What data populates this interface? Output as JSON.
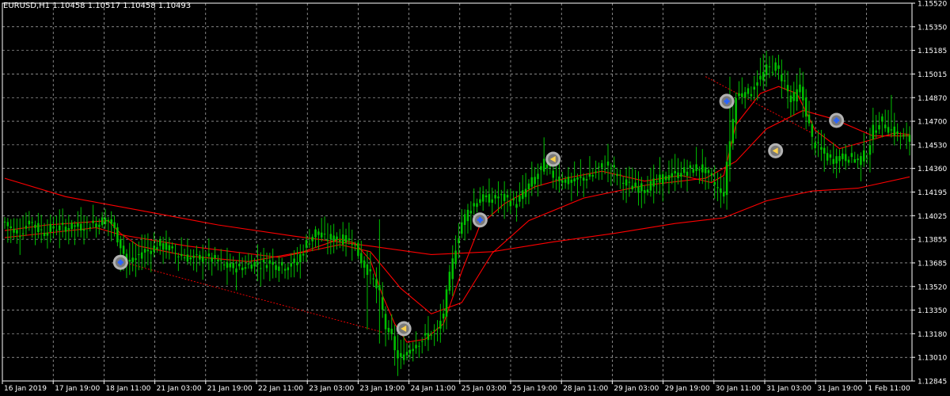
{
  "header": {
    "title": "EURUSD,H1  1.10458 1.10517 1.10458 1.10493"
  },
  "colors": {
    "background": "#000000",
    "grid": "#ffffff",
    "axis": "#ffffff",
    "candle": "#00c000",
    "ma": "#ff0000",
    "signal_buy_fill": "#2a64ff",
    "signal_sell_fill": "#ffd24a",
    "signal_ring": "#bcbcbc"
  },
  "chart_data": {
    "type": "candlestick",
    "symbol": "EURUSD",
    "timeframe": "H1",
    "ohlc_header": "1.10458 1.10517 1.10458 1.10493",
    "ylim": [
      1.12845,
      1.1552
    ],
    "y_ticks": [
      "1.15520",
      "1.15350",
      "1.15185",
      "1.15015",
      "1.14870",
      "1.14700",
      "1.14530",
      "1.14360",
      "1.14195",
      "1.14025",
      "1.13855",
      "1.13685",
      "1.13520",
      "1.13350",
      "1.13180",
      "1.13010",
      "1.12845"
    ],
    "x_ticks": [
      "16 Jan 2019",
      "17 Jan 19:00",
      "18 Jan 11:00",
      "21 Jan 03:00",
      "21 Jan 19:00",
      "22 Jan 11:00",
      "23 Jan 03:00",
      "23 Jan 19:00",
      "24 Jan 11:00",
      "25 Jan 03:00",
      "25 Jan 19:00",
      "28 Jan 11:00",
      "29 Jan 03:00",
      "29 Jan 19:00",
      "30 Jan 11:00",
      "31 Jan 03:00",
      "31 Jan 19:00",
      "1 Feb 11:00"
    ],
    "grid": true,
    "close_path": [
      [
        0,
        1.1397
      ],
      [
        2,
        1.1392
      ],
      [
        5,
        1.1389
      ],
      [
        8,
        1.1398
      ],
      [
        11,
        1.1392
      ],
      [
        13,
        1.139
      ],
      [
        16,
        1.1393
      ],
      [
        19,
        1.1393
      ],
      [
        22,
        1.1394
      ],
      [
        25,
        1.1394
      ],
      [
        28,
        1.1396
      ],
      [
        30,
        1.1396
      ],
      [
        33,
        1.1399
      ],
      [
        35,
        1.1396
      ],
      [
        38,
        1.1381
      ],
      [
        40,
        1.1369
      ],
      [
        42,
        1.1369
      ],
      [
        45,
        1.1376
      ],
      [
        48,
        1.1378
      ],
      [
        51,
        1.1381
      ],
      [
        54,
        1.1378
      ],
      [
        57,
        1.1374
      ],
      [
        60,
        1.1372
      ],
      [
        63,
        1.1371
      ],
      [
        66,
        1.1372
      ],
      [
        69,
        1.137
      ],
      [
        72,
        1.1366
      ],
      [
        75,
        1.1365
      ],
      [
        78,
        1.1365
      ],
      [
        81,
        1.1368
      ],
      [
        84,
        1.1367
      ],
      [
        87,
        1.1369
      ],
      [
        90,
        1.1366
      ],
      [
        93,
        1.1366
      ],
      [
        96,
        1.1369
      ],
      [
        99,
        1.1382
      ],
      [
        102,
        1.139
      ],
      [
        105,
        1.1385
      ],
      [
        108,
        1.1386
      ],
      [
        111,
        1.1385
      ],
      [
        114,
        1.1384
      ],
      [
        117,
        1.137
      ],
      [
        120,
        1.136
      ],
      [
        123,
        1.1345
      ],
      [
        125,
        1.1322
      ],
      [
        127,
        1.1315
      ],
      [
        129,
        1.13
      ],
      [
        131,
        1.1303
      ],
      [
        134,
        1.131
      ],
      [
        137,
        1.1314
      ],
      [
        140,
        1.1319
      ],
      [
        142,
        1.132
      ],
      [
        144,
        1.1333
      ],
      [
        146,
        1.1358
      ],
      [
        148,
        1.138
      ],
      [
        150,
        1.1397
      ],
      [
        153,
        1.1408
      ],
      [
        156,
        1.1414
      ],
      [
        159,
        1.1413
      ],
      [
        162,
        1.1415
      ],
      [
        165,
        1.1413
      ],
      [
        168,
        1.141
      ],
      [
        171,
        1.142
      ],
      [
        174,
        1.1428
      ],
      [
        177,
        1.1438
      ],
      [
        180,
        1.143
      ],
      [
        183,
        1.1427
      ],
      [
        186,
        1.1425
      ],
      [
        189,
        1.1428
      ],
      [
        192,
        1.1429
      ],
      [
        195,
        1.1435
      ],
      [
        198,
        1.1438
      ],
      [
        201,
        1.143
      ],
      [
        204,
        1.1423
      ],
      [
        207,
        1.1422
      ],
      [
        210,
        1.1421
      ],
      [
        213,
        1.1424
      ],
      [
        216,
        1.1428
      ],
      [
        219,
        1.143
      ],
      [
        222,
        1.1432
      ],
      [
        225,
        1.1434
      ],
      [
        228,
        1.1436
      ],
      [
        231,
        1.143
      ],
      [
        234,
        1.142
      ],
      [
        236,
        1.1418
      ],
      [
        238,
        1.1455
      ],
      [
        240,
        1.1485
      ],
      [
        242,
        1.149
      ],
      [
        244,
        1.1488
      ],
      [
        247,
        1.1496
      ],
      [
        250,
        1.1505
      ],
      [
        253,
        1.1507
      ],
      [
        256,
        1.1496
      ],
      [
        258,
        1.1482
      ],
      [
        261,
        1.1492
      ],
      [
        263,
        1.1475
      ],
      [
        265,
        1.1455
      ],
      [
        268,
        1.1447
      ],
      [
        271,
        1.1441
      ],
      [
        274,
        1.1443
      ],
      [
        277,
        1.1443
      ],
      [
        280,
        1.144
      ],
      [
        283,
        1.1446
      ],
      [
        285,
        1.1462
      ],
      [
        288,
        1.1468
      ],
      [
        291,
        1.1462
      ],
      [
        294,
        1.1458
      ],
      [
        297,
        1.1455
      ]
    ],
    "spikes": [
      {
        "i": 38,
        "low": 1.1362
      },
      {
        "i": 119,
        "low": 1.1321
      },
      {
        "i": 123,
        "low": 1.1311
      },
      {
        "i": 123,
        "high": 1.1399
      },
      {
        "i": 129,
        "low": 1.1288
      },
      {
        "i": 177,
        "high": 1.1457
      },
      {
        "i": 235,
        "low": 1.1407
      },
      {
        "i": 238,
        "high": 1.15
      },
      {
        "i": 252,
        "high": 1.1515
      },
      {
        "i": 279,
        "low": 1.1439
      },
      {
        "i": 291,
        "high": 1.1487
      },
      {
        "i": 282,
        "high": 1.146
      }
    ],
    "series": [
      {
        "type": "line",
        "style": "solid",
        "values": [
          [
            0,
            1.1391
          ],
          [
            14,
            1.1395
          ],
          [
            34,
            1.1398
          ],
          [
            38,
            1.1389
          ],
          [
            44,
            1.138
          ],
          [
            60,
            1.1373
          ],
          [
            80,
            1.1369
          ],
          [
            98,
            1.1376
          ],
          [
            110,
            1.1385
          ],
          [
            115,
            1.1382
          ],
          [
            120,
            1.137
          ],
          [
            124,
            1.1345
          ],
          [
            128,
            1.1325
          ],
          [
            132,
            1.1312
          ],
          [
            138,
            1.1314
          ],
          [
            144,
            1.1325
          ],
          [
            150,
            1.1362
          ],
          [
            156,
            1.1395
          ],
          [
            164,
            1.141
          ],
          [
            174,
            1.1422
          ],
          [
            184,
            1.1428
          ],
          [
            196,
            1.1433
          ],
          [
            210,
            1.1426
          ],
          [
            222,
            1.143
          ],
          [
            232,
            1.1425
          ],
          [
            236,
            1.143
          ],
          [
            240,
            1.1466
          ],
          [
            248,
            1.1488
          ],
          [
            254,
            1.1493
          ],
          [
            260,
            1.1488
          ],
          [
            266,
            1.1462
          ],
          [
            274,
            1.1449
          ],
          [
            284,
            1.1455
          ],
          [
            292,
            1.146
          ],
          [
            297,
            1.1459
          ]
        ]
      },
      {
        "type": "line",
        "style": "solid",
        "values": [
          [
            0,
            1.1386
          ],
          [
            30,
            1.1393
          ],
          [
            38,
            1.1388
          ],
          [
            60,
            1.138
          ],
          [
            90,
            1.1372
          ],
          [
            110,
            1.1381
          ],
          [
            120,
            1.1376
          ],
          [
            130,
            1.135
          ],
          [
            140,
            1.1332
          ],
          [
            150,
            1.134
          ],
          [
            160,
            1.1375
          ],
          [
            172,
            1.1398
          ],
          [
            190,
            1.1414
          ],
          [
            210,
            1.1423
          ],
          [
            230,
            1.1428
          ],
          [
            240,
            1.144
          ],
          [
            250,
            1.1463
          ],
          [
            262,
            1.1476
          ],
          [
            272,
            1.147
          ],
          [
            285,
            1.1458
          ],
          [
            297,
            1.1458
          ]
        ]
      },
      {
        "type": "line",
        "style": "solid",
        "values": [
          [
            0,
            1.1428
          ],
          [
            20,
            1.1415
          ],
          [
            45,
            1.1405
          ],
          [
            70,
            1.1395
          ],
          [
            95,
            1.1387
          ],
          [
            120,
            1.138
          ],
          [
            140,
            1.1374
          ],
          [
            160,
            1.1376
          ],
          [
            180,
            1.1383
          ],
          [
            200,
            1.1389
          ],
          [
            220,
            1.1396
          ],
          [
            236,
            1.14
          ],
          [
            250,
            1.1412
          ],
          [
            265,
            1.1419
          ],
          [
            280,
            1.1421
          ],
          [
            297,
            1.1429
          ]
        ]
      },
      {
        "type": "line",
        "style": "dotted",
        "values": [
          [
            38,
            1.1369
          ],
          [
            124,
            1.1319
          ]
        ]
      },
      {
        "type": "line",
        "style": "dotted",
        "values": [
          [
            230,
            1.15
          ],
          [
            265,
            1.146
          ]
        ]
      }
    ],
    "signals": [
      {
        "i": 38,
        "price": 1.13685,
        "kind": "buy"
      },
      {
        "i": 131,
        "price": 1.13215,
        "kind": "sell"
      },
      {
        "i": 156,
        "price": 1.13985,
        "kind": "buy"
      },
      {
        "i": 180,
        "price": 1.14415,
        "kind": "sell"
      },
      {
        "i": 237,
        "price": 1.14825,
        "kind": "buy"
      },
      {
        "i": 253,
        "price": 1.14475,
        "kind": "sell"
      },
      {
        "i": 273,
        "price": 1.1469,
        "kind": "buy"
      }
    ]
  }
}
